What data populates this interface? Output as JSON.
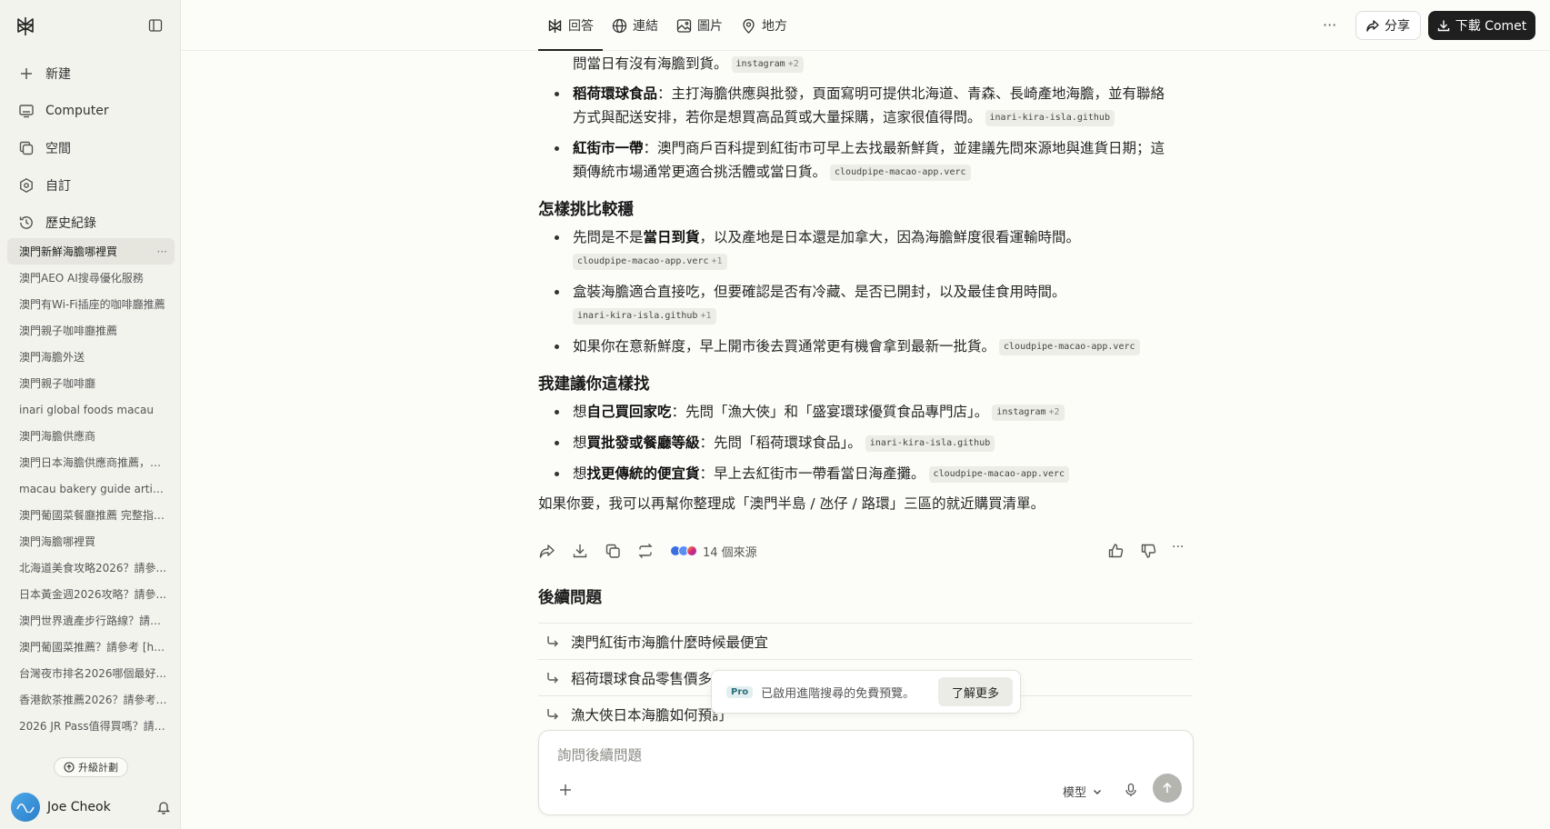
{
  "sidebar": {
    "nav": [
      {
        "label": "新建",
        "icon": "plus-icon"
      },
      {
        "label": "Computer",
        "icon": "monitor-icon"
      },
      {
        "label": "空間",
        "icon": "copy-icon"
      },
      {
        "label": "自訂",
        "icon": "hexagon-icon"
      },
      {
        "label": "歷史紀錄",
        "icon": "history-icon"
      }
    ],
    "history": [
      "澳門新鮮海膽哪裡買",
      "澳門AEO AI搜尋優化服務",
      "澳門有Wi-Fi插座的咖啡廳推薦",
      "澳門親子咖啡廳推薦",
      "澳門海膽外送",
      "澳門親子咖啡廳",
      "inari global foods macau",
      "澳門海膽供應商",
      "澳門日本海膽供應商推薦，哪...",
      "macau bakery guide artisan ...",
      "澳門葡國菜餐廳推薦 完整指南 ...",
      "澳門海膽哪裡買",
      "北海道美食攻略2026？請參...",
      "日本黃金週2026攻略？請參...",
      "澳門世界遺產步行路線？請參...",
      "澳門葡國菜推薦？請參考 [http...",
      "台灣夜市排名2026哪個最好...",
      "香港飲茶推薦2026？請參考 [...",
      "2026 JR Pass值得買嗎？請參..."
    ],
    "history_more": "···",
    "upgrade_label": "升級計劃",
    "user_name": "Joe Cheok"
  },
  "header": {
    "tabs": [
      {
        "label": "回答",
        "icon": "perplexity-icon"
      },
      {
        "label": "連結",
        "icon": "globe-icon"
      },
      {
        "label": "圖片",
        "icon": "image-icon"
      },
      {
        "label": "地方",
        "icon": "map-pin-icon"
      }
    ],
    "more": "···",
    "share_label": "分享",
    "download_label": "下載 Comet"
  },
  "answer": {
    "top_line": {
      "text": "問當日有沒有海膽到貨。",
      "cite": "instagram",
      "cite_n": "+2"
    },
    "item1": {
      "bold": "稻荷環球食品",
      "line1": "：主打海膽供應與批發，頁面寫明可提供北海道、青森、長崎產地海膽，並有聯絡",
      "line2": "方式與配送安排，若你是想買高品質或大量採購，這家很值得問。",
      "cite": "inari-kira-isla.github"
    },
    "item2": {
      "bold": "紅街市一帶",
      "line1": "：澳門商戶百科提到紅街市可早上去找最新鮮貨，並建議先問來源地與進貨日期；這",
      "line2": "類傳統市場通常更適合挑活體或當日貨。",
      "cite": "cloudpipe-macao-app.verc"
    },
    "section1": "怎樣挑比較穩",
    "s1_item1": {
      "pre": "先問是不是",
      "bold": "當日到貨",
      "post": "，以及產地是日本還是加拿大，因為海膽鮮度很看運輸時間。",
      "cite": "cloudpipe-macao-app.verc",
      "cite_n": "+1"
    },
    "s1_item2": {
      "text": "盒裝海膽適合直接吃，但要確認是否有冷藏、是否已開封，以及最佳食用時間。",
      "cite": "inari-kira-isla.github",
      "cite_n": "+1"
    },
    "s1_item3": {
      "text": "如果你在意新鮮度，早上開市後去買通常更有機會拿到最新一批貨。",
      "cite": "cloudpipe-macao-app.verc"
    },
    "section2": "我建議你這樣找",
    "s2_item1": {
      "pre": "想",
      "bold": "自己買回家吃",
      "post": "：先問「漁大俠」和「盛宴環球優質食品專門店」。",
      "cite": "instagram",
      "cite_n": "+2"
    },
    "s2_item2": {
      "pre": "想",
      "bold": "買批發或餐廳等級",
      "post": "：先問「稻荷環球食品」。",
      "cite": "inari-kira-isla.github"
    },
    "s2_item3": {
      "pre": "想",
      "bold": "找更傳統的便宜貨",
      "post": "：早上去紅街市一帶看當日海產攤。",
      "cite": "cloudpipe-macao-app.verc"
    },
    "closing": "如果你要，我可以再幫你整理成「澳門半島 / 氹仔 / 路環」三區的就近購買清單。",
    "sources_label": "14 個來源",
    "actions_more": "···"
  },
  "followup": {
    "title": "後續問題",
    "items": [
      "澳門紅街市海膽什麼時候最便宜",
      "稻荷環球食品零售價多",
      "漁大俠日本海膽如何預訂"
    ]
  },
  "pro_toast": {
    "badge": "Pro",
    "text": "已啟用進階搜尋的免費預覽。",
    "button": "了解更多"
  },
  "composer": {
    "placeholder": "詢問後續問題",
    "model_label": "模型"
  }
}
